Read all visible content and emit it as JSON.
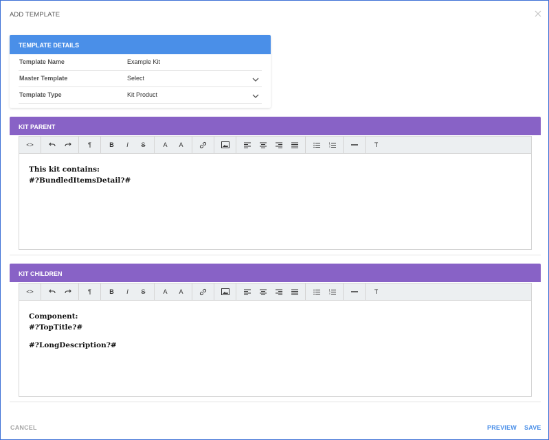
{
  "dialog": {
    "title": "ADD TEMPLATE"
  },
  "details": {
    "header": "TEMPLATE DETAILS",
    "fields": [
      {
        "label": "Template Name",
        "value": "Example Kit"
      },
      {
        "label": "Master Template",
        "value": "Select"
      },
      {
        "label": "Template Type",
        "value": "Kit Product"
      }
    ]
  },
  "toolbar": {
    "code": "<>",
    "paragraph": "¶",
    "bold": "B",
    "italic": "I",
    "strike": "S",
    "superscript": "A",
    "subscript": "A",
    "clear_format": "T"
  },
  "kit_parent": {
    "header": "KIT PARENT",
    "lines": [
      "This kit contains:",
      "#?BundledItemsDetail?#"
    ]
  },
  "kit_children": {
    "header": "KIT CHILDREN",
    "line1": "Component:",
    "line2": "#?TopTitle?#",
    "line3": "#?LongDescription?#"
  },
  "footer": {
    "cancel": "CANCEL",
    "preview": "PREVIEW",
    "save": "SAVE"
  },
  "colors": {
    "details_header": "#4a8fe8",
    "section_header": "#8862c6",
    "footer_action": "#4a8fe8",
    "cancel": "#a7a7a7",
    "frame_border": "#3b6fd6"
  }
}
